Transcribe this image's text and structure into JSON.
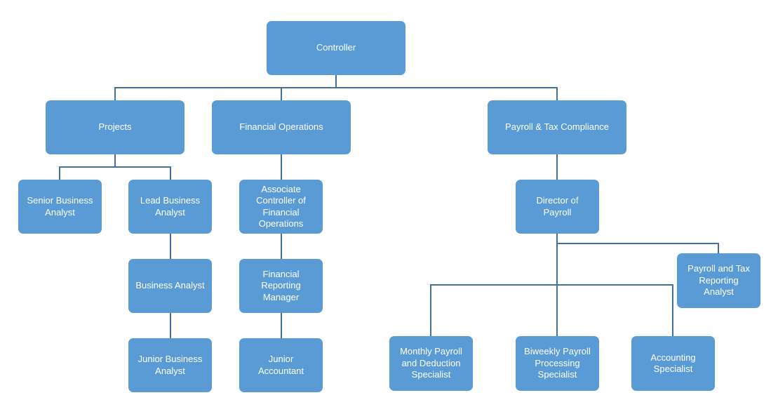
{
  "diagram": {
    "type": "org-chart",
    "colors": {
      "node_fill": "#5b9bd5",
      "node_text": "#ffffff",
      "connector": "#41719c",
      "background": "#ffffff"
    },
    "nodes": [
      {
        "id": "controller",
        "label": "Controller",
        "parent": null
      },
      {
        "id": "projects",
        "label": "Projects",
        "parent": "controller"
      },
      {
        "id": "financial-operations",
        "label": "Financial Operations",
        "parent": "controller"
      },
      {
        "id": "payroll-tax-compliance",
        "label": "Payroll & Tax Compliance",
        "parent": "controller"
      },
      {
        "id": "senior-business-analyst",
        "label": "Senior Business\nAnalyst",
        "parent": "projects"
      },
      {
        "id": "lead-business-analyst",
        "label": "Lead Business\nAnalyst",
        "parent": "projects"
      },
      {
        "id": "business-analyst",
        "label": "Business Analyst",
        "parent": "lead-business-analyst"
      },
      {
        "id": "junior-business-analyst",
        "label": "Junior Business\nAnalyst",
        "parent": "business-analyst"
      },
      {
        "id": "associate-controller",
        "label": "Associate\nController of\nFinancial\nOperations",
        "parent": "financial-operations"
      },
      {
        "id": "financial-reporting-manager",
        "label": "Financial\nReporting\nManager",
        "parent": "associate-controller"
      },
      {
        "id": "junior-accountant",
        "label": "Junior\nAccountant",
        "parent": "financial-reporting-manager"
      },
      {
        "id": "director-of-payroll",
        "label": "Director of\nPayroll",
        "parent": "payroll-tax-compliance"
      },
      {
        "id": "payroll-tax-reporting-analyst",
        "label": "Payroll and Tax\nReporting\nAnalyst",
        "parent": "director-of-payroll"
      },
      {
        "id": "monthly-payroll-specialist",
        "label": "Monthly Payroll\nand Deduction\nSpecialist",
        "parent": "director-of-payroll"
      },
      {
        "id": "biweekly-payroll-specialist",
        "label": "Biweekly Payroll\nProcessing\nSpecialist",
        "parent": "director-of-payroll"
      },
      {
        "id": "accounting-specialist",
        "label": "Accounting\nSpecialist",
        "parent": "director-of-payroll"
      }
    ]
  }
}
